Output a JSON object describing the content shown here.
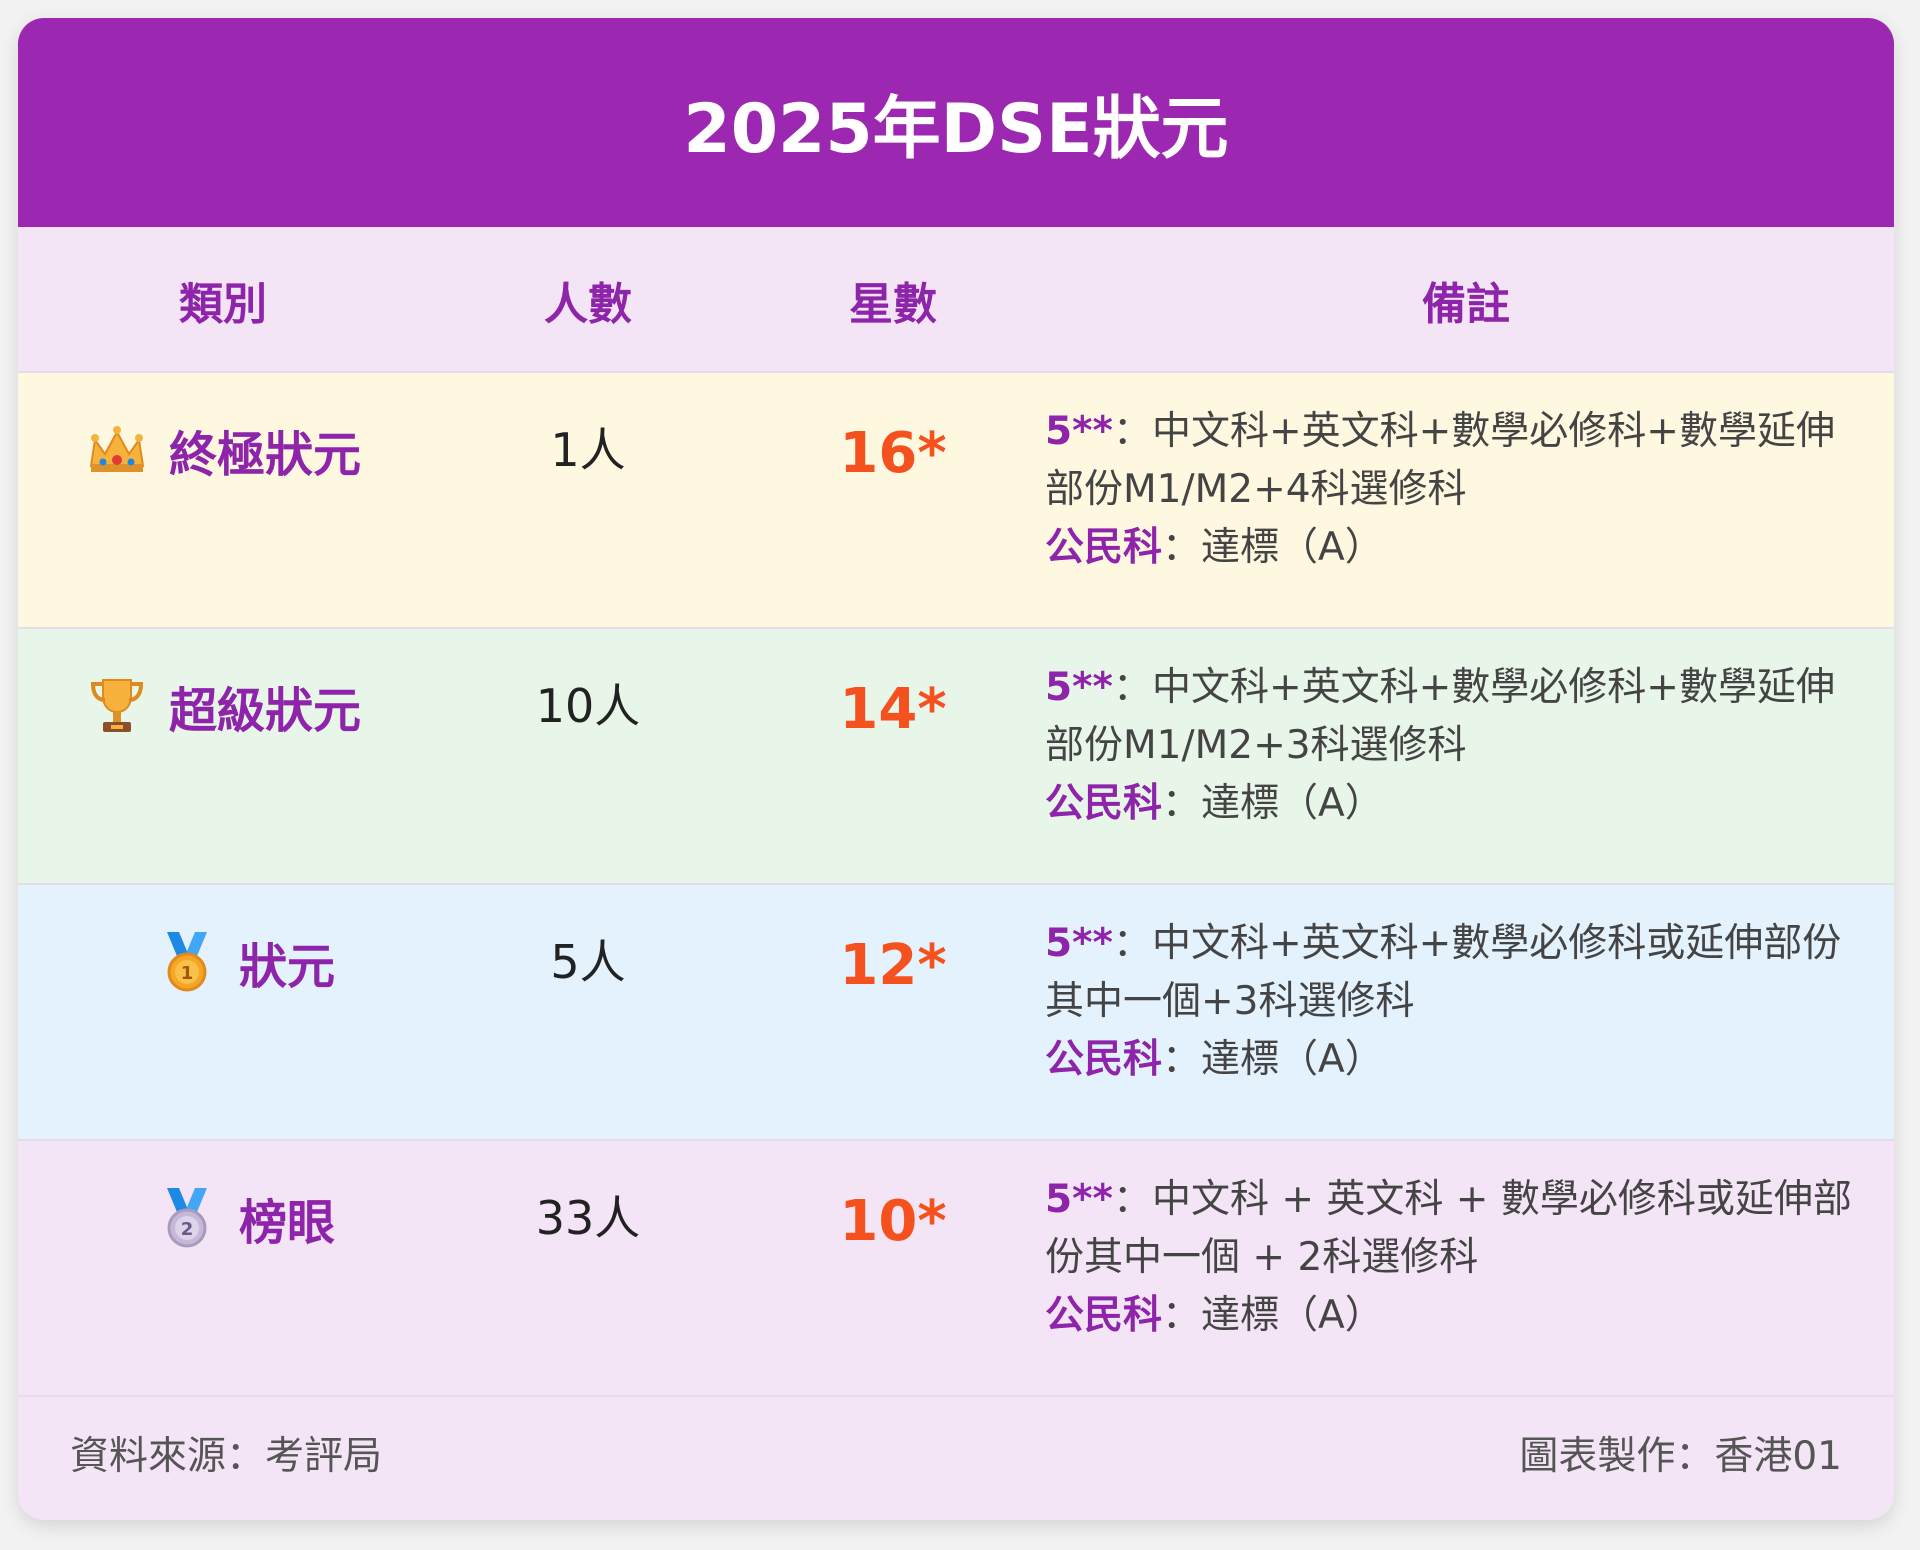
{
  "title": "2025年DSE狀元",
  "columns": {
    "category": "類別",
    "count": "人數",
    "stars": "星數",
    "remarks": "備註"
  },
  "rows": [
    {
      "icon": "crown-icon",
      "category": "終極狀元",
      "count": "1人",
      "stars": "16*",
      "remark_key1": "5**",
      "remark_text1": "：中文科+英文科+數學必修科+數學延伸部份M1/M2+4科選修科",
      "remark_key2": "公民科",
      "remark_text2": "：達標（A）"
    },
    {
      "icon": "trophy-icon",
      "category": "超級狀元",
      "count": "10人",
      "stars": "14*",
      "remark_key1": "5**",
      "remark_text1": "：中文科+英文科+數學必修科+數學延伸部份M1/M2+3科選修科",
      "remark_key2": "公民科",
      "remark_text2": "：達標（A）"
    },
    {
      "icon": "gold-medal-icon",
      "category": "狀元",
      "count": "5人",
      "stars": "12*",
      "remark_key1": "5**",
      "remark_text1": "：中文科+英文科+數學必修科或延伸部份其中一個+3科選修科",
      "remark_key2": "公民科",
      "remark_text2": "：達標（A）"
    },
    {
      "icon": "silver-medal-icon",
      "category": "榜眼",
      "count": "33人",
      "stars": "10*",
      "remark_key1": "5**",
      "remark_text1": "：中文科 + 英文科 + 數學必修科或延伸部份其中一個 + 2科選修科",
      "remark_key2": "公民科",
      "remark_text2": "：達標（A）"
    }
  ],
  "footer": {
    "source": "資料來源：考評局",
    "credit": "圖表製作：香港01"
  },
  "colors": {
    "primary": "#9c27b0",
    "accent_text": "#8e24aa",
    "star_text": "#f4511e",
    "row_bg": [
      "#fff8e1",
      "#e8f5e9",
      "#e3f2fd",
      "#f3e5f5"
    ]
  }
}
